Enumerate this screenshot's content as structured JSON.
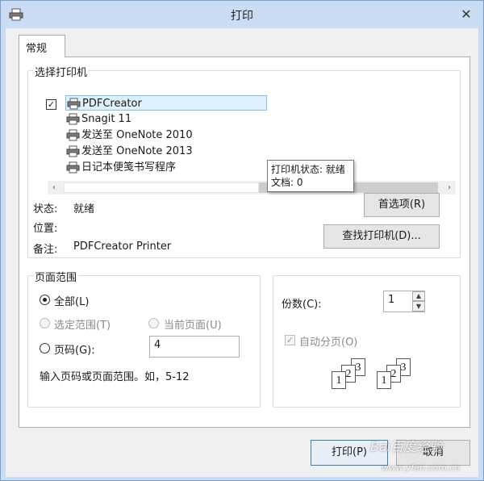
{
  "window": {
    "title": "打印",
    "close_glyph": "✕",
    "accent": "#c9dcf3"
  },
  "tabs": [
    {
      "label": "常规"
    }
  ],
  "printer_group": {
    "label": "选择打印机",
    "printers": [
      {
        "name": "PDFCreator",
        "checked": true,
        "selected": true
      },
      {
        "name": "Snagit 11"
      },
      {
        "name": "发送至 OneNote 2010"
      },
      {
        "name": "发送至 OneNote 2013"
      },
      {
        "name": "日记本便笺书写程序"
      }
    ],
    "scroll_left": "‹",
    "scroll_right": "›",
    "tooltip": {
      "status": "打印机状态: 就绪",
      "docs": "文档: 0"
    },
    "status_label": "状态:",
    "status_value": "就绪",
    "location_label": "位置:",
    "comment_label": "备注:",
    "comment_value": "PDFCreator Printer",
    "preferences_button": "首选项(R)",
    "find_printer_button": "查找打印机(D)..."
  },
  "page_range": {
    "label": "页面范围",
    "all": "全部(L)",
    "selection": "选定范围(T)",
    "current_page": "当前页面(U)",
    "pages": "页码(G):",
    "pages_value": "4",
    "hint": "输入页码或页面范围。如，5-12"
  },
  "copies": {
    "label": "份数(C):",
    "value": "1",
    "collate": "自动分页(O)",
    "collate_checked": true,
    "collate_pages": [
      "1",
      "2",
      "3"
    ]
  },
  "footer": {
    "print_button": "打印(P)",
    "cancel_button": "取消"
  },
  "watermark": {
    "brand": "Bai百度经验",
    "url": "www.yfan.com.cn"
  }
}
